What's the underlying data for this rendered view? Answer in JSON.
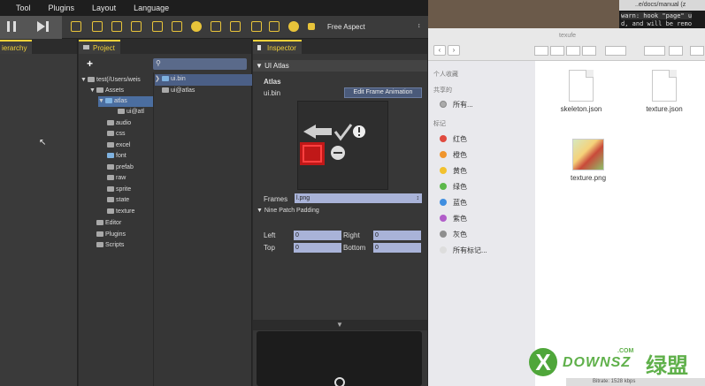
{
  "menubar": {
    "items": [
      "Tool",
      "Plugins",
      "Layout",
      "Language"
    ]
  },
  "toolbar": {
    "aspect_label": "Free Aspect"
  },
  "tabs": {
    "hierarchy": "ierarchy",
    "project": "Project",
    "inspector": "Inspector"
  },
  "project": {
    "tree": [
      {
        "label": "test(/Users/weis",
        "depth": 0
      },
      {
        "label": "Assets",
        "depth": 1
      },
      {
        "label": "atlas",
        "depth": 2
      },
      {
        "label": "ui@atl",
        "depth": 3
      },
      {
        "label": "audio",
        "depth": 2
      },
      {
        "label": "css",
        "depth": 2
      },
      {
        "label": "excel",
        "depth": 2
      },
      {
        "label": "font",
        "depth": 2
      },
      {
        "label": "prefab",
        "depth": 2
      },
      {
        "label": "raw",
        "depth": 2
      },
      {
        "label": "sprite",
        "depth": 2
      },
      {
        "label": "state",
        "depth": 2
      },
      {
        "label": "texture",
        "depth": 2
      },
      {
        "label": "Editor",
        "depth": 1
      },
      {
        "label": "Plugins",
        "depth": 1
      },
      {
        "label": "Scripts",
        "depth": 1
      }
    ],
    "assets": [
      "ui.bin",
      "ui@atlas"
    ]
  },
  "inspector": {
    "title": "UI Atlas",
    "section": "Atlas",
    "file": "ui.bin",
    "edit_button": "Edit Frame Animation",
    "frames_label": "Frames",
    "frames_value": "l.png",
    "nine_patch": "Nine Patch Padding",
    "left_label": "Left",
    "left_value": "0",
    "right_label": "Right",
    "right_value": "0",
    "top_label": "Top",
    "top_value": "0",
    "bottom_label": "Bottom",
    "bottom_value": "0"
  },
  "terminal": {
    "title": "..e/docs/manual (z",
    "line1": "warn: hook \"page\" u",
    "line2": "d, and will be remo"
  },
  "finder": {
    "title": "texufe",
    "sidebar": {
      "personal_header": "个人收藏",
      "shared_header": "共享的",
      "shared_item": "所有...",
      "tags_header": "标记",
      "tags": [
        {
          "label": "红色",
          "color": "#e04a3f"
        },
        {
          "label": "橙色",
          "color": "#f0952c"
        },
        {
          "label": "黄色",
          "color": "#f2c12e"
        },
        {
          "label": "绿色",
          "color": "#5cb84a"
        },
        {
          "label": "蓝色",
          "color": "#3f8ee0"
        },
        {
          "label": "紫色",
          "color": "#b15dc9"
        },
        {
          "label": "灰色",
          "color": "#8e8e8e"
        }
      ],
      "all_tags": "所有标记..."
    },
    "files": [
      "skeleton.json",
      "texture.json",
      "texture.png"
    ]
  },
  "watermark": {
    "text": "DOWNSZ",
    "cn": "绿盟",
    "com": ".COM"
  },
  "status": {
    "text": "Bitrate: 1528 kbps"
  }
}
